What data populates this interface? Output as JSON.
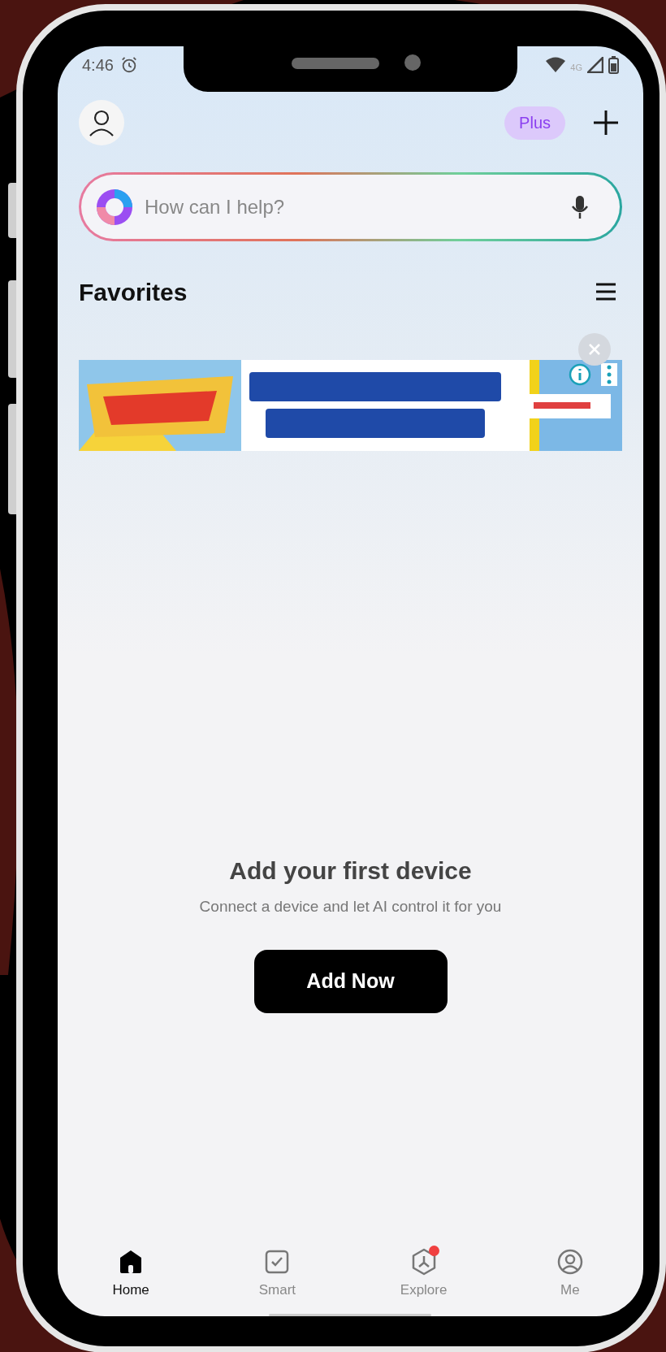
{
  "status_bar": {
    "time": "4:46",
    "network": "4G"
  },
  "header": {
    "plan_badge": "Plus"
  },
  "search": {
    "placeholder": "How can I help?"
  },
  "favorites": {
    "title": "Favorites"
  },
  "empty_state": {
    "title": "Add your first device",
    "subtitle": "Connect a device and let AI control it for you",
    "button": "Add Now"
  },
  "nav": [
    {
      "label": "Home",
      "selected": true,
      "badge": false
    },
    {
      "label": "Smart",
      "selected": false,
      "badge": false
    },
    {
      "label": "Explore",
      "selected": false,
      "badge": true
    },
    {
      "label": "Me",
      "selected": false,
      "badge": false
    }
  ]
}
